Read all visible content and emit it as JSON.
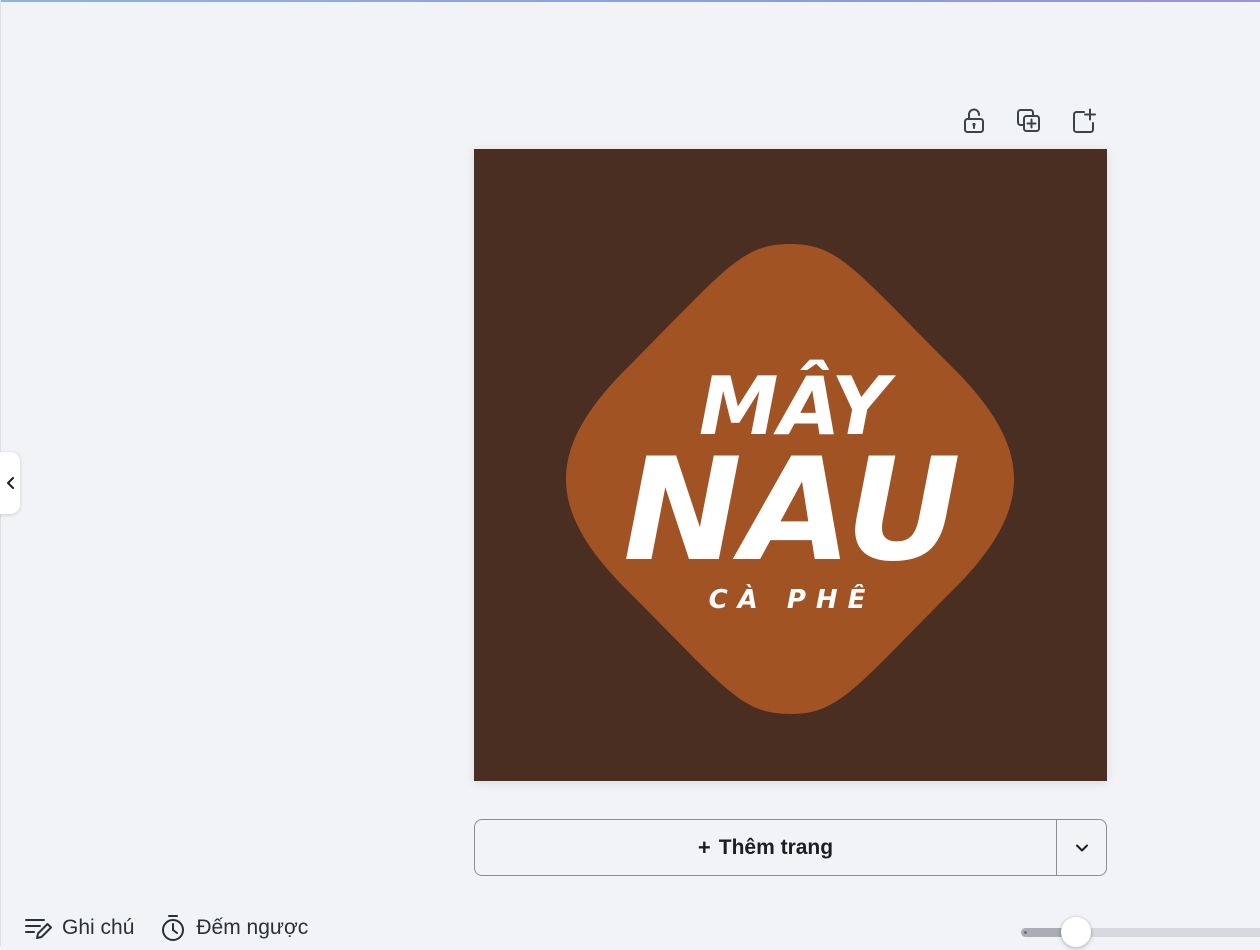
{
  "design": {
    "brand_line1": "MÂY",
    "brand_line2": "NAU",
    "brand_sub": "CÀ PHÊ",
    "background_color": "#4a2e21",
    "shape_color": "#a25324",
    "text_color": "#ffffff"
  },
  "page_toolbar": {
    "icons": [
      "unlock-icon",
      "duplicate-page-icon",
      "add-page-icon"
    ]
  },
  "add_page": {
    "label": "Thêm trang",
    "plus": "+"
  },
  "footer": {
    "notes_label": "Ghi chú",
    "timer_label": "Đếm ngược"
  },
  "zoom": {
    "level": 0.21
  },
  "colors": {
    "workspace_bg": "#f2f3f7",
    "border": "#8a8f96"
  }
}
